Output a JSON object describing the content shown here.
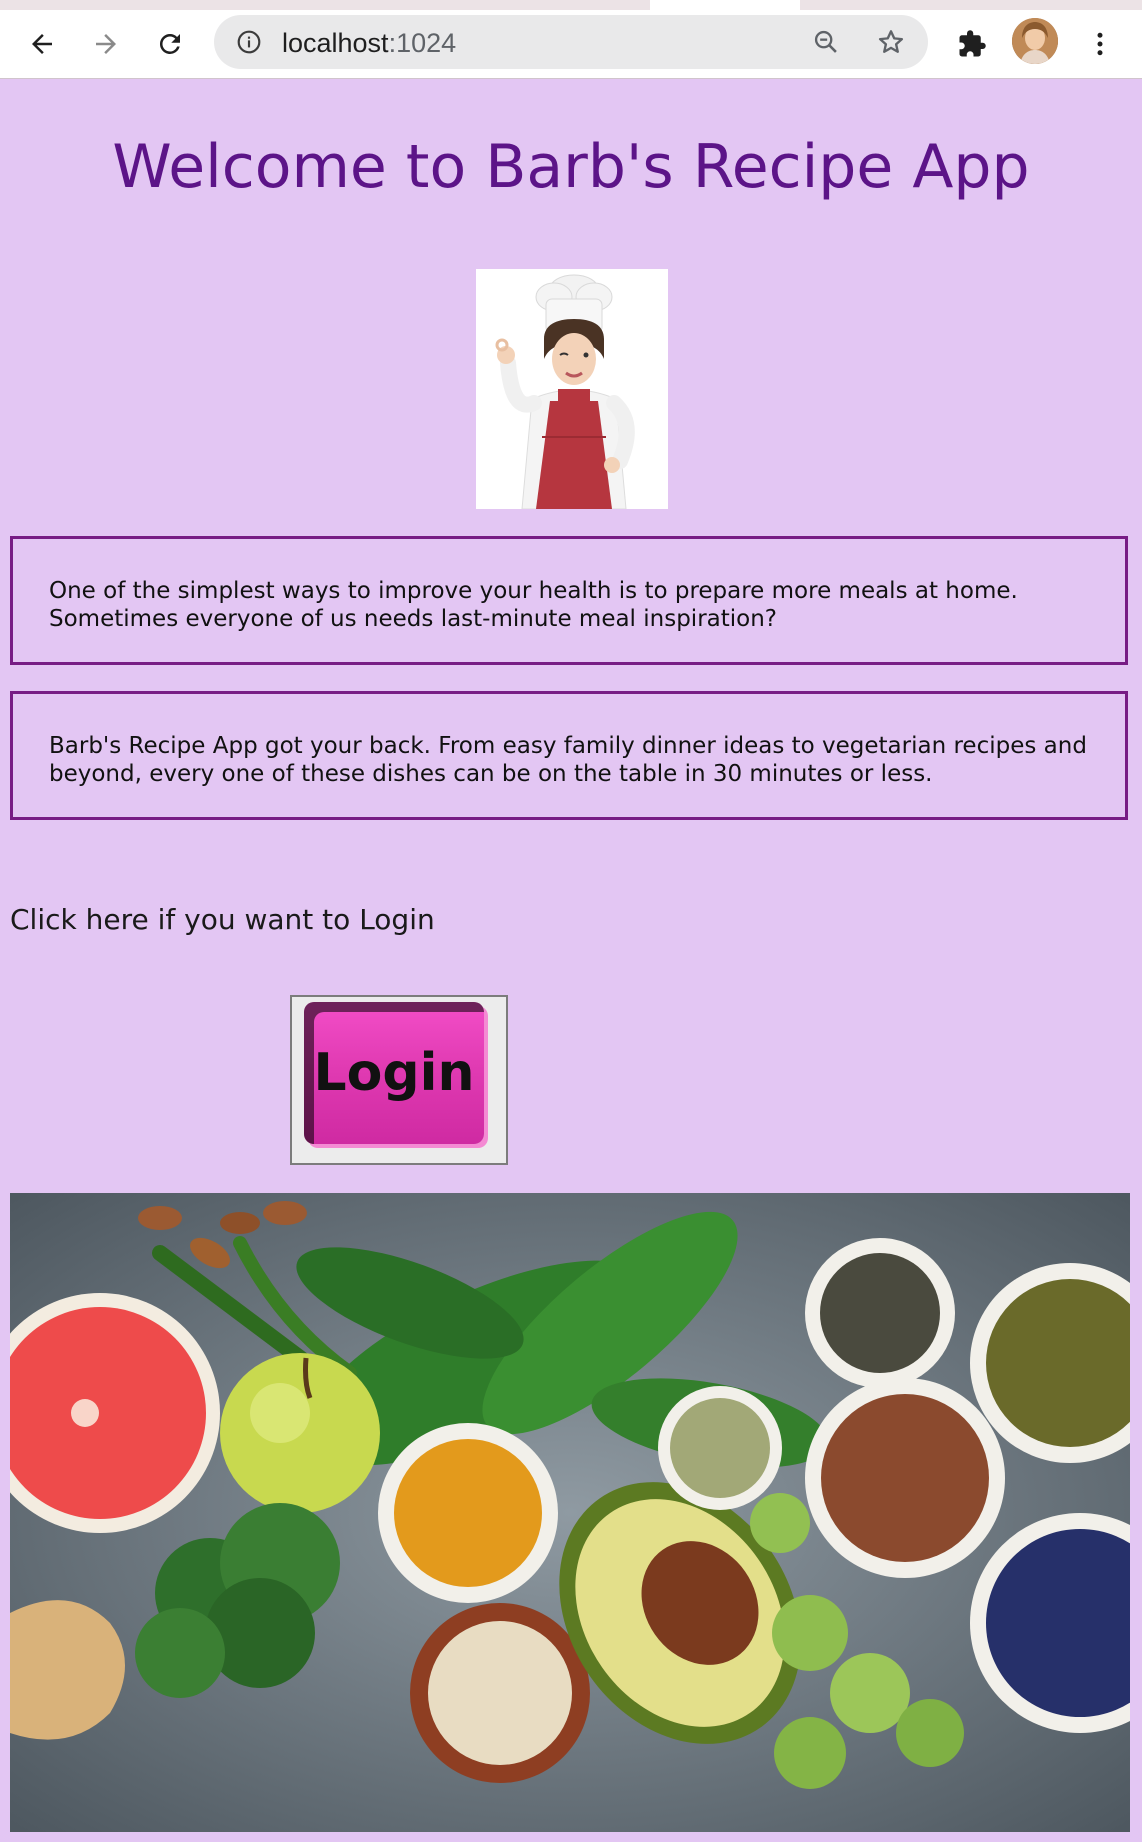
{
  "browser": {
    "url_host": "localhost",
    "url_port": ":1024",
    "icons": [
      "back-arrow-icon",
      "forward-arrow-icon",
      "reload-icon",
      "site-info-icon",
      "zoom-out-icon",
      "star-icon",
      "extensions-puzzle-icon",
      "profile-avatar",
      "more-vert-icon"
    ]
  },
  "page": {
    "title": "Welcome to Barb's Recipe App",
    "intro_1": "One of the simplest ways to improve your health is to prepare more meals at home. Sometimes everyone of us needs last-minute meal inspiration?",
    "intro_2": "Barb's Recipe App got your back. From easy family dinner ideas to vegetarian recipes and beyond, every one of these dishes can be on the table in 30 minutes or less.",
    "login_prompt": "Click here if you want to Login",
    "login_button_label": "Login"
  },
  "colors": {
    "background": "#e3c6f3",
    "title": "#5c1488",
    "box_border": "#771c84",
    "login_button": "#e13bb3"
  }
}
